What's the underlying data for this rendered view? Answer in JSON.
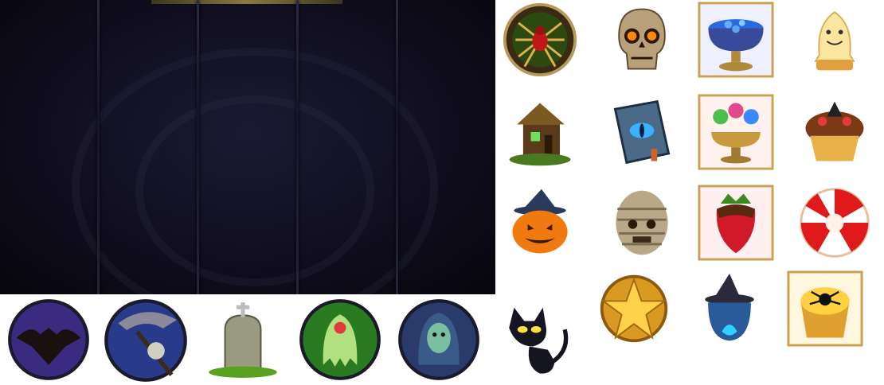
{
  "scene": "slot-symbol-atlas",
  "reel_panel": {
    "columns": 5,
    "colors": {
      "bg": "#100e1f",
      "divider": "#2a2a40"
    }
  },
  "symbols": [
    {
      "name": "spider-medallion-icon",
      "group": "premium"
    },
    {
      "name": "skull-icon",
      "group": "premium"
    },
    {
      "name": "cauldron-bowl-icon",
      "group": "premium"
    },
    {
      "name": "ghost-cake-icon",
      "group": "premium"
    },
    {
      "name": "witch-house-icon",
      "group": "premium"
    },
    {
      "name": "spellbook-icon",
      "group": "premium"
    },
    {
      "name": "lollipop-bowl-icon",
      "group": "premium"
    },
    {
      "name": "witch-cupcake-icon",
      "group": "premium"
    },
    {
      "name": "jack-o-lantern-icon",
      "group": "premium"
    },
    {
      "name": "mummy-head-icon",
      "group": "premium"
    },
    {
      "name": "chocolate-strawberry-icon",
      "group": "premium"
    },
    {
      "name": "peppermint-candy-icon",
      "group": "premium"
    },
    {
      "name": "star-medallion-icon",
      "group": "special"
    },
    {
      "name": "witch-hat-icon",
      "group": "special"
    },
    {
      "name": "spider-tart-icon",
      "group": "special"
    },
    {
      "name": "bat-medallion-icon",
      "group": "low"
    },
    {
      "name": "reaper-scythe-medallion-icon",
      "group": "low"
    },
    {
      "name": "tombstone-icon",
      "group": "low"
    },
    {
      "name": "green-ghost-medallion-icon",
      "group": "low"
    },
    {
      "name": "hooded-zombie-medallion-icon",
      "group": "low"
    },
    {
      "name": "black-cat-icon",
      "group": "low"
    }
  ]
}
